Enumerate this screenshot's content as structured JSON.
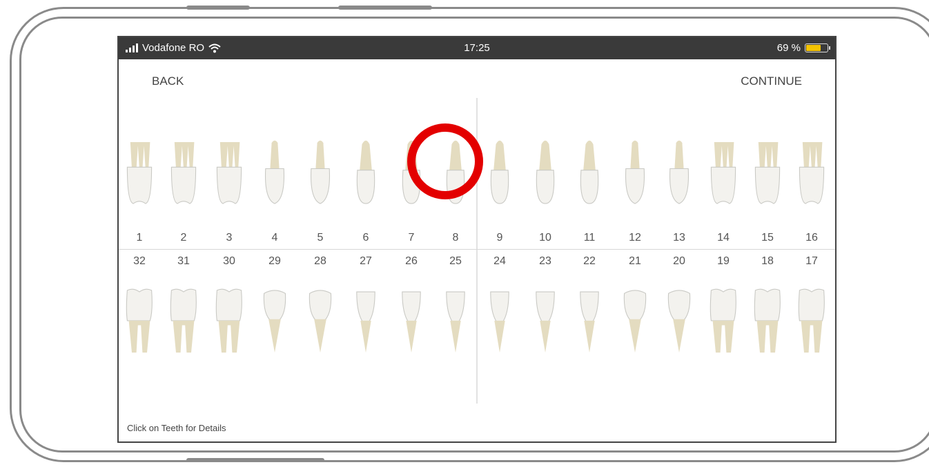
{
  "status_bar": {
    "carrier": "Vodafone RO",
    "time": "17:25",
    "battery_percent_label": "69 %",
    "battery_level": 0.69
  },
  "nav": {
    "back_label": "BACK",
    "continue_label": "CONTINUE"
  },
  "teeth": {
    "upper": [
      "1",
      "2",
      "3",
      "4",
      "5",
      "6",
      "7",
      "8",
      "9",
      "10",
      "11",
      "12",
      "13",
      "14",
      "15",
      "16"
    ],
    "lower": [
      "32",
      "31",
      "30",
      "29",
      "28",
      "27",
      "26",
      "25",
      "24",
      "23",
      "22",
      "21",
      "20",
      "19",
      "18",
      "17"
    ],
    "selected": "8"
  },
  "footer": {
    "hint": "Click on Teeth for Details"
  },
  "colors": {
    "highlight": "#e30000",
    "status_bar": "#3a3a3a",
    "battery": "#f4c400"
  },
  "icons": {
    "signal": "signal-icon",
    "wifi": "wifi-icon",
    "battery": "battery-icon"
  }
}
